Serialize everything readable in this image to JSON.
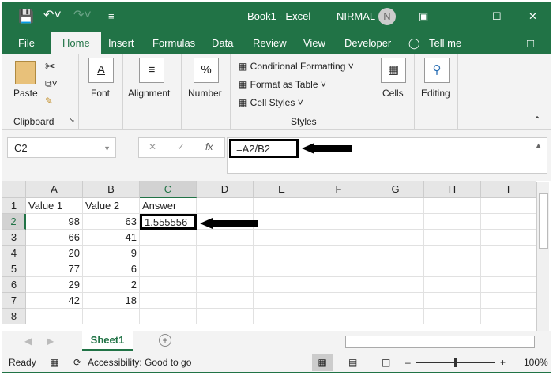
{
  "titlebar": {
    "title": "Book1  -  Excel",
    "user": "NIRMAL",
    "avatar_initial": "N"
  },
  "tabs": [
    "File",
    "Home",
    "Insert",
    "Formulas",
    "Data",
    "Review",
    "View",
    "Developer",
    "Tell me"
  ],
  "ribbon": {
    "paste": "Paste",
    "clipboard": "Clipboard",
    "font": "Font",
    "alignment": "Alignment",
    "number": "Number",
    "conditional": "Conditional Formatting",
    "format_table": "Format as Table",
    "cell_styles": "Cell Styles",
    "styles": "Styles",
    "cells": "Cells",
    "editing": "Editing"
  },
  "formula_bar": {
    "name_box": "C2",
    "formula": "=A2/B2"
  },
  "columns": [
    "A",
    "B",
    "C",
    "D",
    "E",
    "F",
    "G",
    "H",
    "I"
  ],
  "rows": [
    "1",
    "2",
    "3",
    "4",
    "5",
    "6",
    "7",
    "8"
  ],
  "cells": {
    "header": [
      "Value 1",
      "Value 2",
      "Answer"
    ],
    "a": [
      "98",
      "66",
      "20",
      "77",
      "29",
      "42"
    ],
    "b": [
      "63",
      "41",
      "9",
      "6",
      "2",
      "18"
    ],
    "c2": "1.555556"
  },
  "sheet_tab": "Sheet1",
  "status": {
    "ready": "Ready",
    "accessibility": "Accessibility: Good to go",
    "zoom": "100%",
    "zoom_percent": 100
  },
  "colors": {
    "brand": "#217346"
  }
}
